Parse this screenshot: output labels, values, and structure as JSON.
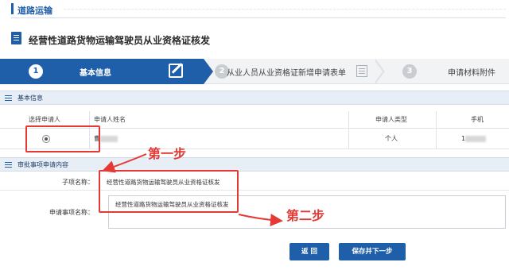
{
  "section": {
    "title": "道路运输"
  },
  "page": {
    "heading": "经营性道路货物运输驾驶员从业资格证核发"
  },
  "steps": [
    {
      "num": "1",
      "label": "基本信息",
      "state": "active"
    },
    {
      "num": "2",
      "label": "从业人员从业资格证新增申请表单",
      "state": "inactive"
    },
    {
      "num": "3",
      "label": "申请材料附件",
      "state": "inactive"
    }
  ],
  "basic_info": {
    "title": "基本信息",
    "columns": [
      "选择申请人",
      "申请人姓名",
      "申请人类型",
      "手机"
    ],
    "rows": [
      {
        "applicant_name": "曹",
        "applicant_type": "个人",
        "phone": "1"
      }
    ]
  },
  "approval": {
    "title": "审批事项申请内容",
    "sub_item_label": "子项名称：",
    "sub_item_value": "经营性道路货物运输驾驶员从业资格证核发",
    "apply_item_label": "申请事项名称：",
    "apply_item_value": "经营性道路货物运输驾驶员从业资格证核发"
  },
  "buttons": {
    "back": "返 回",
    "save_next": "保存并下一步"
  },
  "annotations": {
    "step_one": "第一步",
    "step_two": "第二步"
  },
  "colors": {
    "primary": "#1f5ea8",
    "annotation": "#e53935"
  }
}
